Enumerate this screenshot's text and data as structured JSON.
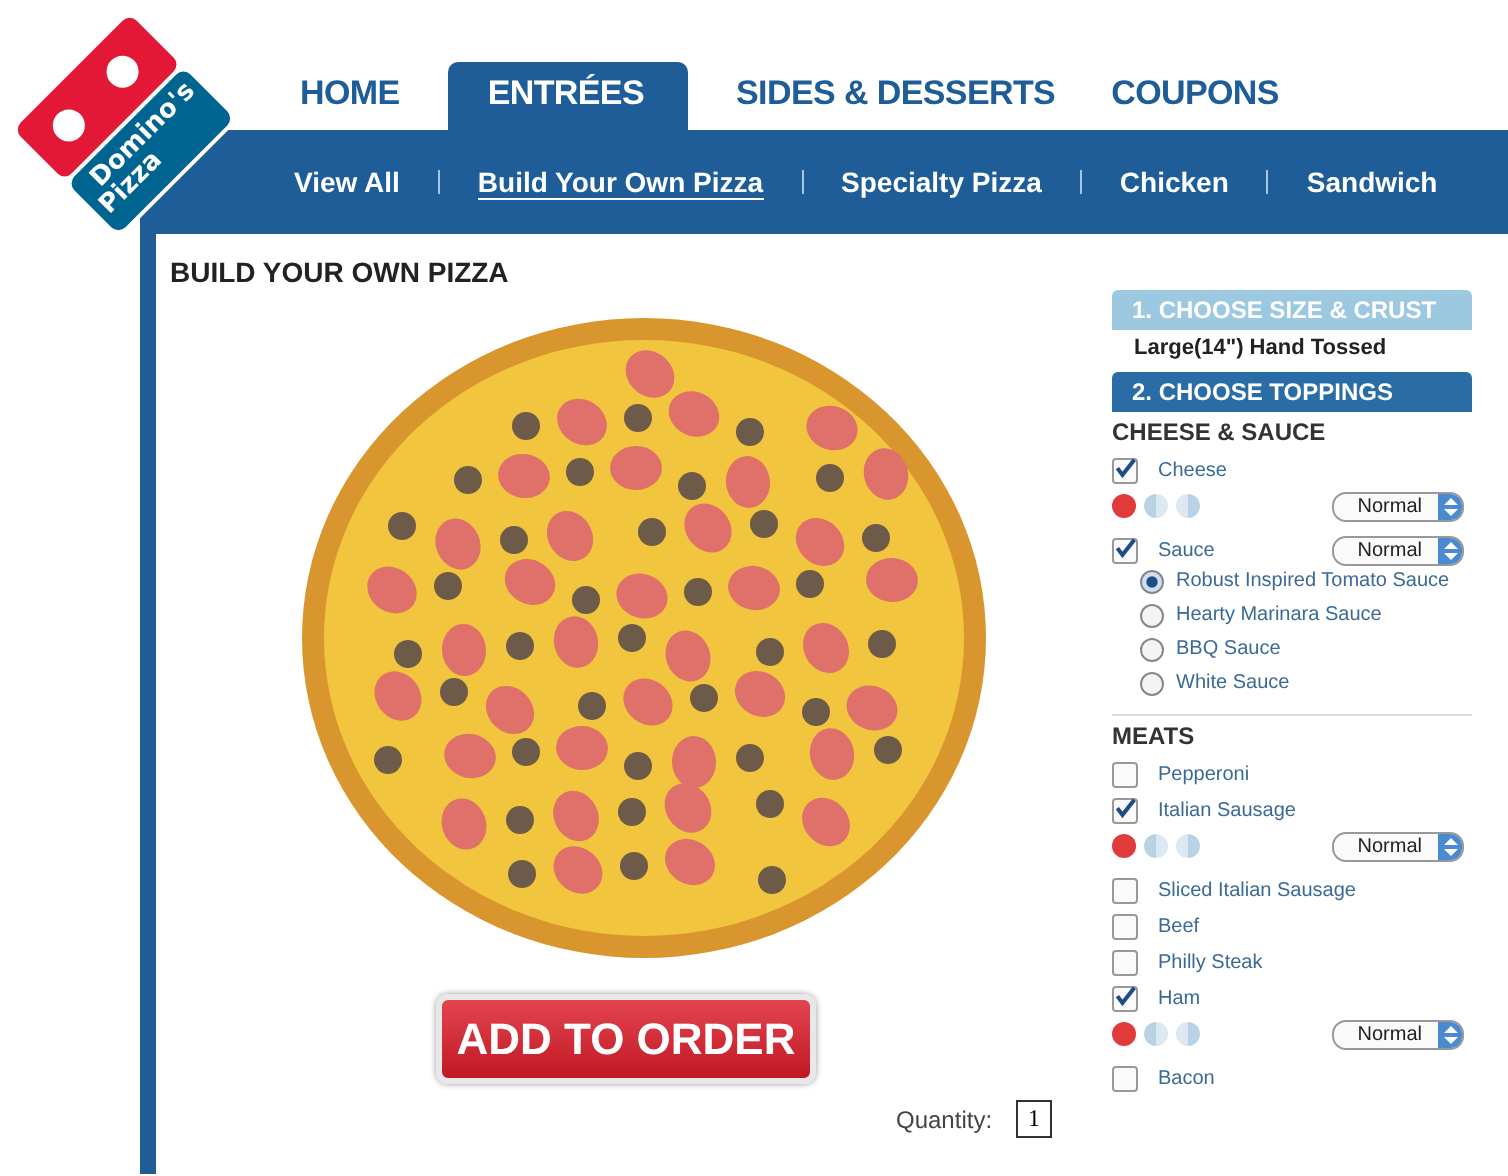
{
  "logo": {
    "line_1": "Domino's",
    "line_2": "Pizza"
  },
  "tabs": [
    {
      "label": "HOME",
      "selected": false
    },
    {
      "label": "ENTRÉES",
      "selected": true
    },
    {
      "label": "SIDES & DESSERTS",
      "selected": false
    },
    {
      "label": "COUPONS",
      "selected": false
    }
  ],
  "subnav": [
    {
      "label": "View All",
      "selected": false
    },
    {
      "label": "Build Your Own Pizza",
      "selected": true
    },
    {
      "label": "Specialty Pizza",
      "selected": false
    },
    {
      "label": "Chicken",
      "selected": false
    },
    {
      "label": "Sandwich",
      "selected": false
    }
  ],
  "page_title": "BUILD YOUR OWN PIZZA",
  "add_button": "ADD TO ORDER",
  "quantity": {
    "label": "Quantity:",
    "value": "1"
  },
  "steps": [
    {
      "title": "1. CHOOSE SIZE & CRUST",
      "active": false,
      "summary": "Large(14\") Hand Tossed"
    },
    {
      "title": "2. CHOOSE TOPPINGS",
      "active": true
    }
  ],
  "sections": [
    {
      "title": "CHEESE & SAUCE",
      "items": [
        {
          "kind": "checkbox",
          "label": "Cheese",
          "checked": true,
          "sides": [
            {
              "selected": true
            },
            {
              "selected": false
            },
            {
              "selected": false
            }
          ],
          "amount": "Normal"
        },
        {
          "kind": "checkbox",
          "label": "Sauce",
          "checked": true,
          "inline_amount": "Normal"
        },
        {
          "kind": "radio",
          "label": "Robust Inspired Tomato Sauce",
          "selected": true
        },
        {
          "kind": "radio",
          "label": "Hearty Marinara Sauce",
          "selected": false
        },
        {
          "kind": "radio",
          "label": "BBQ Sauce",
          "selected": false
        },
        {
          "kind": "radio",
          "label": "White Sauce",
          "selected": false
        }
      ]
    },
    {
      "title": "MEATS",
      "items": [
        {
          "kind": "checkbox",
          "label": "Pepperoni",
          "checked": false
        },
        {
          "kind": "checkbox",
          "label": "Italian Sausage",
          "checked": true,
          "sides": [
            {
              "selected": true
            },
            {
              "selected": false
            },
            {
              "selected": false
            }
          ],
          "amount": "Normal"
        },
        {
          "kind": "checkbox",
          "label": "Sliced Italian Sausage",
          "checked": false
        },
        {
          "kind": "checkbox",
          "label": "Beef",
          "checked": false
        },
        {
          "kind": "checkbox",
          "label": "Philly Steak",
          "checked": false
        },
        {
          "kind": "checkbox",
          "label": "Ham",
          "checked": true,
          "sides": [
            {
              "selected": true
            },
            {
              "selected": false
            },
            {
              "selected": false
            }
          ],
          "amount": "Normal"
        },
        {
          "kind": "checkbox",
          "label": "Bacon",
          "checked": false
        }
      ]
    }
  ]
}
